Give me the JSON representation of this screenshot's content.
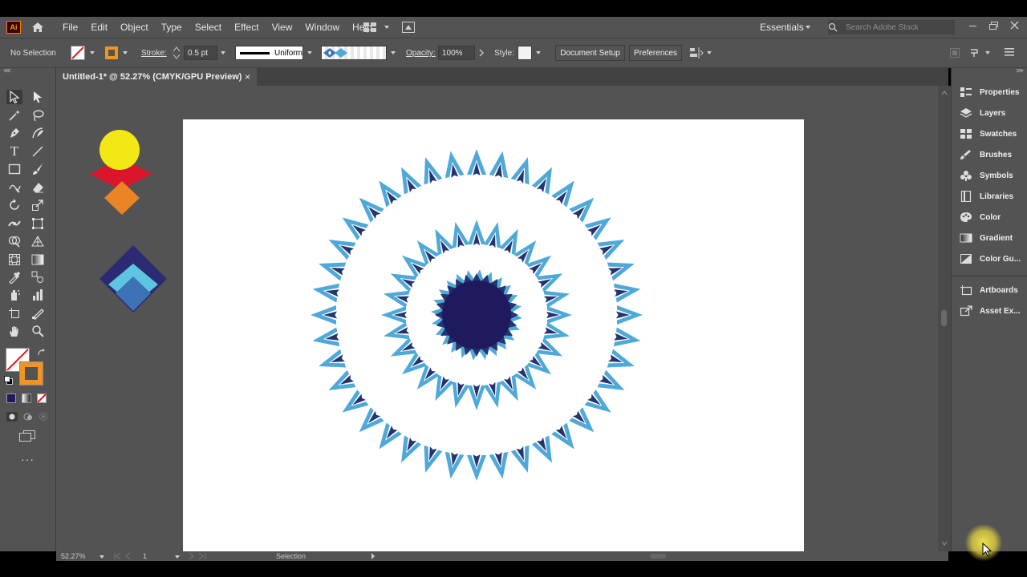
{
  "app": {
    "logo_text": "Ai",
    "workspace": "Essentials",
    "search_placeholder": "Search Adobe Stock"
  },
  "menu": [
    "File",
    "Edit",
    "Object",
    "Type",
    "Select",
    "Effect",
    "View",
    "Window",
    "Help"
  ],
  "control": {
    "selection": "No Selection",
    "stroke_label": "Stroke:",
    "stroke_value": "0.5 pt",
    "profile": "Uniform",
    "opacity_label": "Opacity:",
    "opacity_value": "100%",
    "style_label": "Style:",
    "document_setup": "Document Setup",
    "preferences": "Preferences"
  },
  "document_tab": {
    "title": "Untitled-1* @ 52.27% (CMYK/GPU Preview)",
    "close": "×"
  },
  "panels": [
    "Properties",
    "Layers",
    "Swatches",
    "Brushes",
    "Symbols",
    "Libraries",
    "Color",
    "Gradient",
    "Color Gu...",
    "Artboards",
    "Asset Ex..."
  ],
  "status": {
    "zoom": "52.27%",
    "artboard_num": "1",
    "tool": "Selection"
  },
  "colors": {
    "ui_panel": "#535353",
    "artwork_light_blue": "#4ea9d8",
    "artwork_dark_blue": "#25336e",
    "artwork_navy": "#1f1a5e",
    "yellow": "#f2e813",
    "red": "#d9162b",
    "orange": "#ea8426",
    "diamond_navy": "#2c2a73",
    "diamond_cyan": "#5cc5e0",
    "diamond_blue": "#3d72b5",
    "fill_swatch_orange": "#f29322"
  }
}
